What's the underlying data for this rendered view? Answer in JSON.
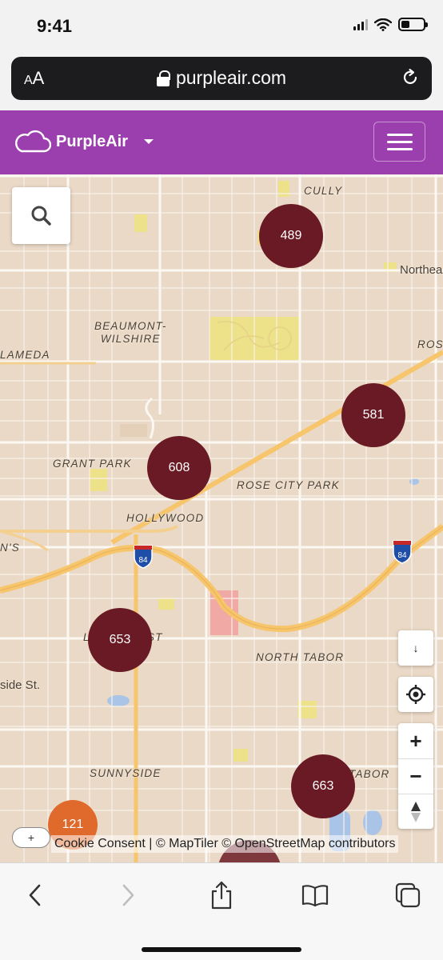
{
  "status_bar": {
    "time": "9:41"
  },
  "url_bar": {
    "text_size_big": "A",
    "text_size_small": "A",
    "domain": "purpleair.com"
  },
  "app": {
    "brand": "PurpleAir",
    "accent_color": "#9b3fae"
  },
  "map": {
    "places": {
      "cully": "CULLY",
      "northeast": "Northea",
      "beaumont_wilshire": "BEAUMONT-\nWILSHIRE",
      "rose": "ROSE",
      "alameda": "LAMEDA",
      "grant_park": "GRANT PARK",
      "rose_city_park": "ROSE CITY PARK",
      "hollywood": "HOLLYWOOD",
      "ns": "N'S",
      "laurelhurst_left": "L",
      "laurelhurst_right": "ST",
      "north_tabor": "NORTH TABOR",
      "burnside": "side St.",
      "sunnyside": "SUNNYSIDE",
      "tabor": "TABOR"
    },
    "highway_shields": [
      "84",
      "84"
    ],
    "clusters": [
      {
        "value": "489",
        "level": "dark"
      },
      {
        "value": "581",
        "level": "dark"
      },
      {
        "value": "608",
        "level": "dark"
      },
      {
        "value": "653",
        "level": "dark"
      },
      {
        "value": "663",
        "level": "dark"
      },
      {
        "value": "121",
        "level": "orange"
      }
    ],
    "controls": {
      "search_icon": "search-icon",
      "north_arrow": "↓",
      "zoom_in": "+",
      "zoom_out": "−",
      "compass": "compass-icon"
    },
    "attribution_toggle": "+",
    "attribution": "Cookie Consent | © MapTiler © OpenStreetMap contributors"
  },
  "toolbar": [
    "back-icon",
    "forward-icon",
    "share-icon",
    "bookmarks-icon",
    "tabs-icon"
  ]
}
